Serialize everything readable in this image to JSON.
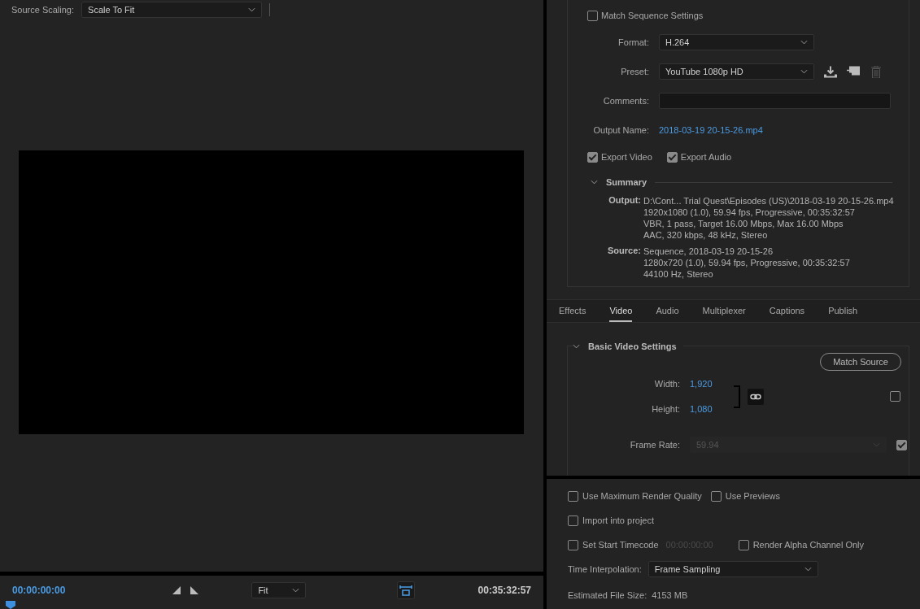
{
  "source_scaling": {
    "label": "Source Scaling:",
    "value": "Scale To Fit"
  },
  "timeline": {
    "current": "00:00:00:00",
    "zoom": "Fit",
    "duration": "00:35:32:57"
  },
  "export": {
    "match_sequence": {
      "label": "Match Sequence Settings",
      "checked": false
    },
    "format": {
      "label": "Format:",
      "value": "H.264"
    },
    "preset": {
      "label": "Preset:",
      "value": "YouTube 1080p HD"
    },
    "comments": {
      "label": "Comments:"
    },
    "output_name": {
      "label": "Output Name:",
      "value": "2018-03-19 20-15-26.mp4"
    },
    "toggles": [
      {
        "label": "Export Video",
        "checked": true
      },
      {
        "label": "Export Audio",
        "checked": true
      }
    ],
    "summary": {
      "title": "Summary",
      "expanded": true,
      "groups": [
        {
          "label": "Output:",
          "lines": [
            "D:\\Cont... Trial Quest\\Episodes (US)\\2018-03-19 20-15-26.mp4",
            "1920x1080 (1.0), 59.94 fps, Progressive, 00:35:32:57",
            "VBR, 1 pass, Target 16.00 Mbps, Max 16.00 Mbps",
            "AAC, 320 kbps, 48 kHz, Stereo"
          ]
        },
        {
          "label": "Source:",
          "lines": [
            "Sequence, 2018-03-19 20-15-26",
            "1280x720 (1.0), 59.94 fps, Progressive, 00:35:32:57",
            "44100 Hz, Stereo"
          ]
        }
      ]
    }
  },
  "tabs": [
    {
      "label": "Effects",
      "selected": false
    },
    {
      "label": "Video",
      "selected": true
    },
    {
      "label": "Audio",
      "selected": false
    },
    {
      "label": "Multiplexer",
      "selected": false
    },
    {
      "label": "Captions",
      "selected": false
    },
    {
      "label": "Publish",
      "selected": false
    }
  ],
  "video": {
    "title": "Basic Video Settings",
    "expanded": true,
    "match_button": "Match Source",
    "width": {
      "label": "Width:",
      "value": "1,920"
    },
    "height": {
      "label": "Height:",
      "value": "1,080"
    },
    "override_checked": false,
    "frame_rate": {
      "label": "Frame Rate:",
      "value": "59.94",
      "checked": true
    }
  },
  "options": [
    [
      {
        "label": "Use Maximum Render Quality",
        "checked": false
      },
      {
        "label": "Use Previews",
        "checked": false
      }
    ],
    [
      {
        "label": "Import into project",
        "checked": false
      }
    ],
    [
      {
        "label": "Set Start Timecode",
        "checked": false,
        "timecode": "00:00:00:00"
      },
      {
        "label": "Render Alpha Channel Only",
        "checked": false
      }
    ]
  ],
  "interpolation": {
    "label": "Time Interpolation:",
    "value": "Frame Sampling"
  },
  "file_size": {
    "label": "Estimated File Size:",
    "value": "4153 MB"
  }
}
